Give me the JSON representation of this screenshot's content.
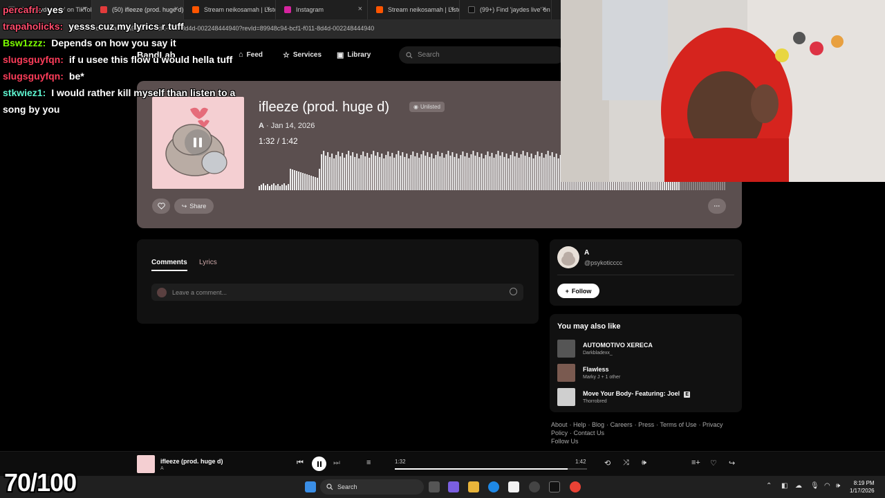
{
  "browser": {
    "tabs": [
      {
        "label": "Find 'jaydes live' on TikTok",
        "color": "#4d4d4d",
        "active": false
      },
      {
        "label": "(50) ifleeze (prod. huge d)",
        "color": "#e23b3b",
        "active": true
      },
      {
        "label": "Stream neikosamah | Listen",
        "color": "#ff5500",
        "active": false
      },
      {
        "label": "Instagram",
        "color": "#d6249f",
        "active": false
      },
      {
        "label": "Stream neikosamah | Listen",
        "color": "#ff5500",
        "active": false
      },
      {
        "label": "(99+) Find 'jaydes live' on",
        "color": "#111111",
        "active": false
      }
    ],
    "url": "bandlab.com/track/8a9a8c94-bcf1-f011-8d4d-002248444940?revId=89948c94-bcf1-f011-8d4d-002248444940"
  },
  "nav": {
    "logo": "BandLab",
    "links": [
      "Feed",
      "Services",
      "Library"
    ],
    "search_placeholder": "Search"
  },
  "track": {
    "title": "ifleeze (prod. huge d)",
    "badge": "Unlisted",
    "artist": "A",
    "date": "· Jan 14, 2026",
    "current_time": "1:32",
    "separator": " / ",
    "duration": "1:42",
    "share_label": "Share",
    "more_label": "···",
    "progress": 0.9
  },
  "comments": {
    "tabs": [
      "Comments",
      "Lyrics"
    ],
    "placeholder": "Leave a comment..."
  },
  "artist_card": {
    "name": "A",
    "handle": "@psykoticccc",
    "follow_label": "Follow"
  },
  "recommendations": {
    "heading": "You may also like",
    "items": [
      {
        "title": "AUTOMOTIVO XERECA",
        "artist": "Darkbladexx_",
        "explicit": false
      },
      {
        "title": "Flawless",
        "artist": "Marky J + 1 other",
        "explicit": false
      },
      {
        "title": "Move Your Body- Featuring: Joel",
        "artist": "Thorrobred",
        "explicit": true
      }
    ]
  },
  "footer": {
    "links": [
      "About",
      "Help",
      "Blog",
      "Careers",
      "Press",
      "Terms of Use",
      "Privacy Policy",
      "Contact Us",
      "Follow Us"
    ]
  },
  "player": {
    "title": "ifleeze (prod. huge d)",
    "artist": "A",
    "current": "1:32",
    "duration": "1:42",
    "progress": 0.9
  },
  "taskbar": {
    "search_label": "Search",
    "time": "8:19 PM",
    "date": "1/17/2026"
  },
  "chat": [
    {
      "user": "percafrl:",
      "msg": "yes",
      "color": "#ff4d6d"
    },
    {
      "user": "trapaholicks:",
      "msg": "yesss cuz my lyrics r tuff",
      "color": "#ff4d6d"
    },
    {
      "user": "Bsw1zzz:",
      "msg": "Depends on how you say it",
      "color": "#7CFC00"
    },
    {
      "user": "slugsguyfqn:",
      "msg": "if u usee this flow u would hella tuff",
      "color": "#ff3d5a"
    },
    {
      "user": "slugsguyfqn:",
      "msg": "be*",
      "color": "#ff3d5a"
    },
    {
      "user": "stkwiez1:",
      "msg": "I would rather kill myself than listen to a song by you",
      "color": "#5ef5d0"
    }
  ],
  "score": "70/100"
}
